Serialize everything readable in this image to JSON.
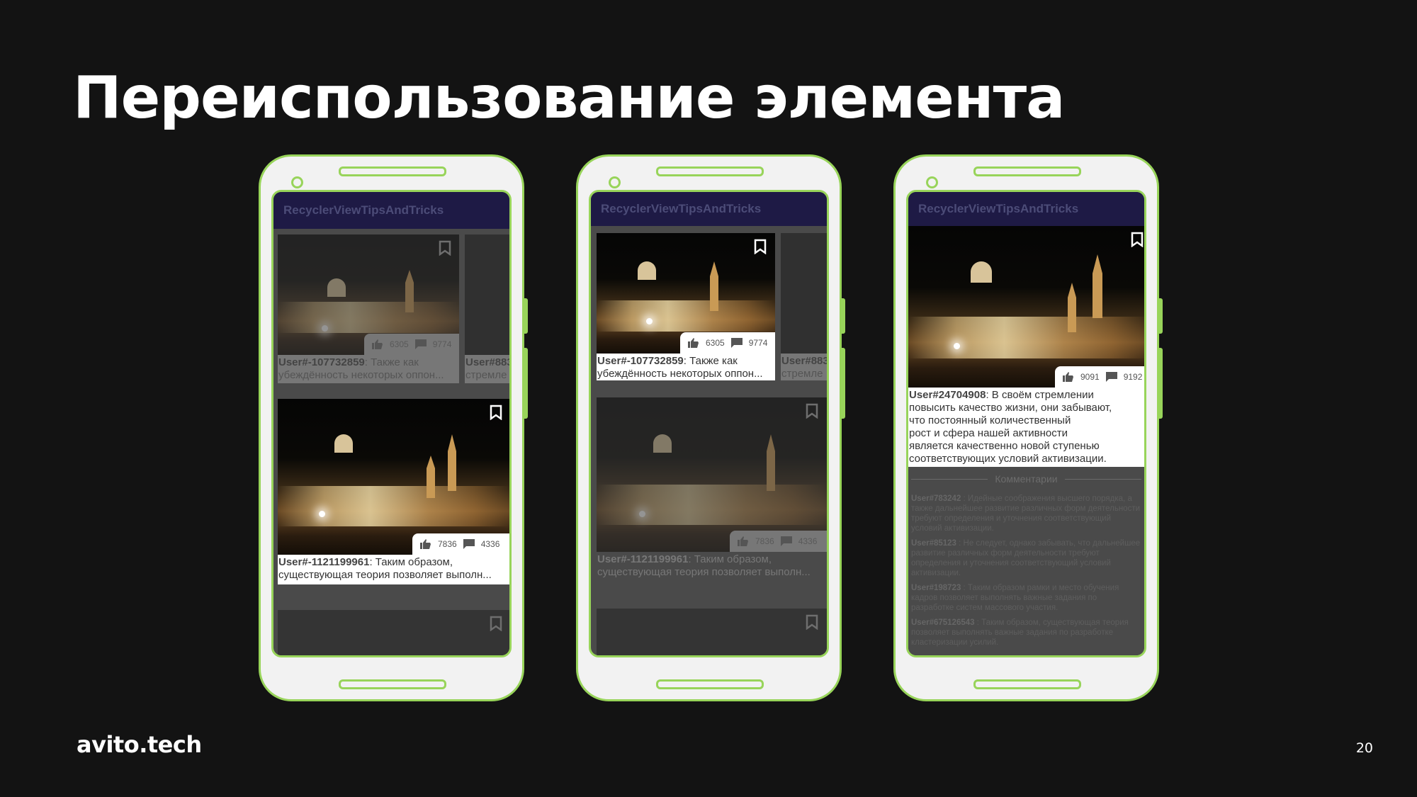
{
  "slide": {
    "title": "Переиспользование элемента",
    "logo": "avito.tech",
    "page_number": "20"
  },
  "app": {
    "title": "RecyclerViewTipsAndTricks"
  },
  "items": {
    "a": {
      "user": "User#-107732859",
      "text1": ": Также как",
      "text2": "убеждённость некоторых оппон...",
      "likes": "6305",
      "comments": "9774"
    },
    "b": {
      "user": "User#-1121199961",
      "text1": ": Таким образом,",
      "text2": "существующая теория позволяет выполн...",
      "likes": "7836",
      "comments": "4336"
    },
    "c": {
      "user": "User#883",
      "text2": "стремле"
    },
    "c2": {
      "user": "User#88",
      "text2": "стремле"
    },
    "d": {
      "user": "User#24704908",
      "text": ": В своём стремлении",
      "lines": [
        "повысить качество жизни, они забывают,",
        "что постоянный количественный",
        "рост и сфера нашей активности",
        "является качественно новой ступенью",
        "соответствующих условий активизации."
      ],
      "likes": "9091",
      "comments": "9192"
    }
  },
  "comments_section": {
    "header": "Комментарии",
    "comments": [
      {
        "user": "User#783242",
        "text": " : Идейные соображения высшего порядка, а также дальнейшее развитие различных форм деятельности требуют определения и уточнения соответствующий условий активизации."
      },
      {
        "user": "User#85123",
        "text": " : Не следует, однако забывать, что дальнейшее развитие различных форм деятельности требуют определения и уточнения соответствующий условий активизации."
      },
      {
        "user": "User#198723",
        "text": " : Таким образом рамки и место обучения кадров позволяет выполнять важные задания по разработке систем массового участия."
      },
      {
        "user": "User#675126543",
        "text": " : Таким образом, существующая теория позволяет выполнять важные задания по разработке кластеризации усилий."
      }
    ]
  }
}
